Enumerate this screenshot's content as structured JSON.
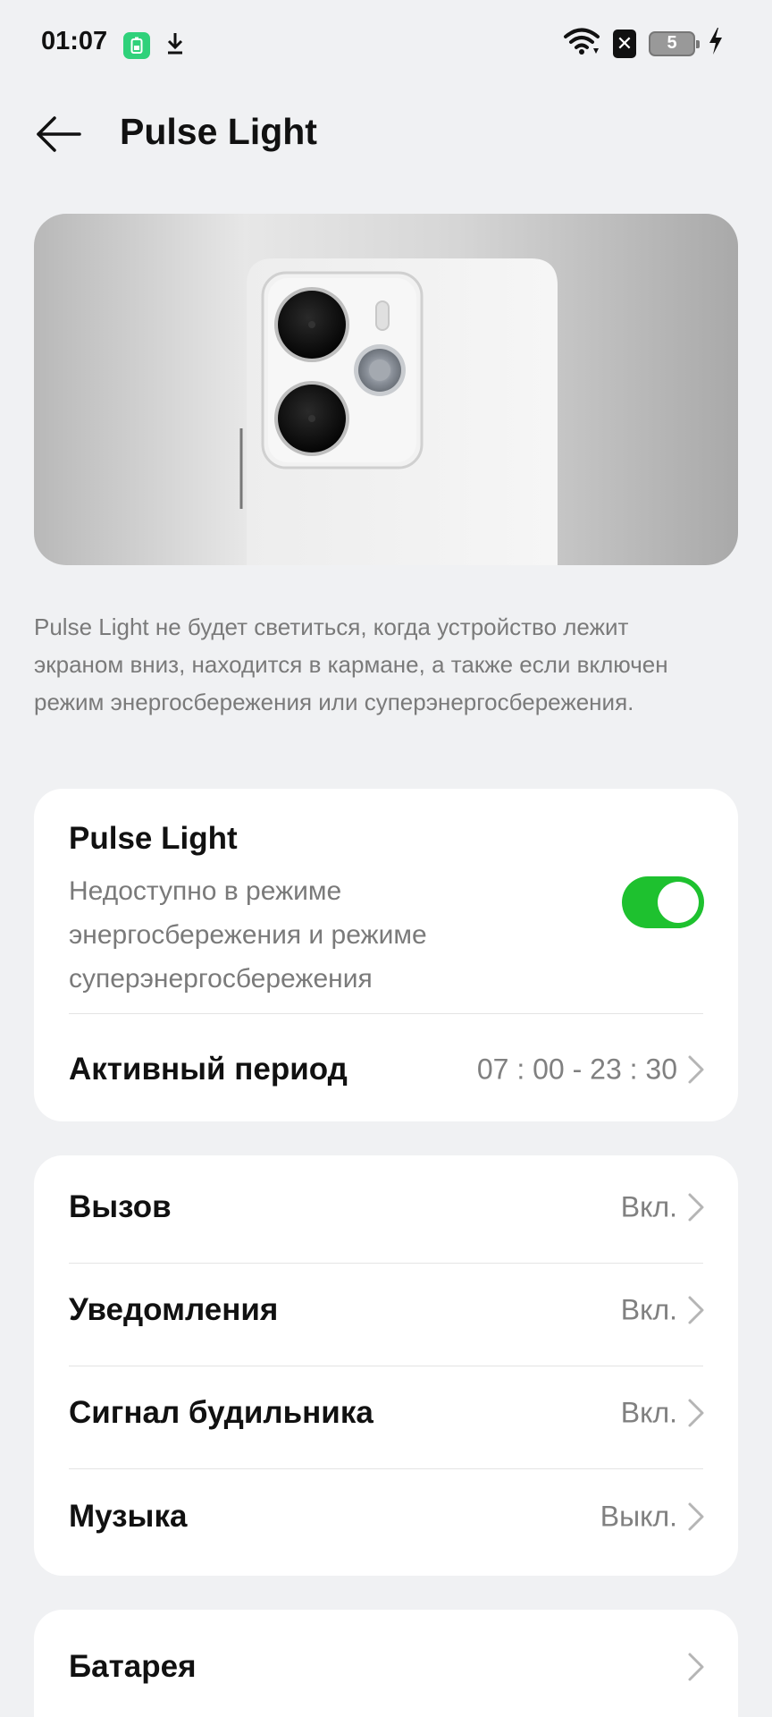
{
  "status_bar": {
    "time": "01:07",
    "battery_level": "5",
    "icons": [
      "battery-saver-icon",
      "download-icon",
      "wifi-icon",
      "sim-off-icon",
      "battery-icon",
      "charging-icon"
    ]
  },
  "header": {
    "title": "Pulse Light",
    "back_icon": "back-arrow-icon"
  },
  "description": "Pulse Light не будет светиться, когда устройство лежит экраном вниз, находится в кармане, а также если включен режим энергосбережения или суперэнергосбережения.",
  "pulse_card": {
    "toggle_title": "Pulse Light",
    "toggle_subtitle": "Недоступно в режиме энергосбережения и режиме суперэнергосбережения",
    "toggle_on": true,
    "active_period_label": "Активный период",
    "active_period_value": "07 : 00 - 23 : 30"
  },
  "events_card": {
    "items": [
      {
        "label": "Вызов",
        "value": "Вкл."
      },
      {
        "label": "Уведомления",
        "value": "Вкл."
      },
      {
        "label": "Сигнал будильника",
        "value": "Вкл."
      },
      {
        "label": "Музыка",
        "value": "Выкл."
      }
    ]
  },
  "battery_card": {
    "label": "Батарея"
  },
  "colors": {
    "background": "#F0F1F3",
    "toggle_on": "#1EC12F",
    "battery_saver": "#2FD17A",
    "secondary_text": "#808080"
  }
}
